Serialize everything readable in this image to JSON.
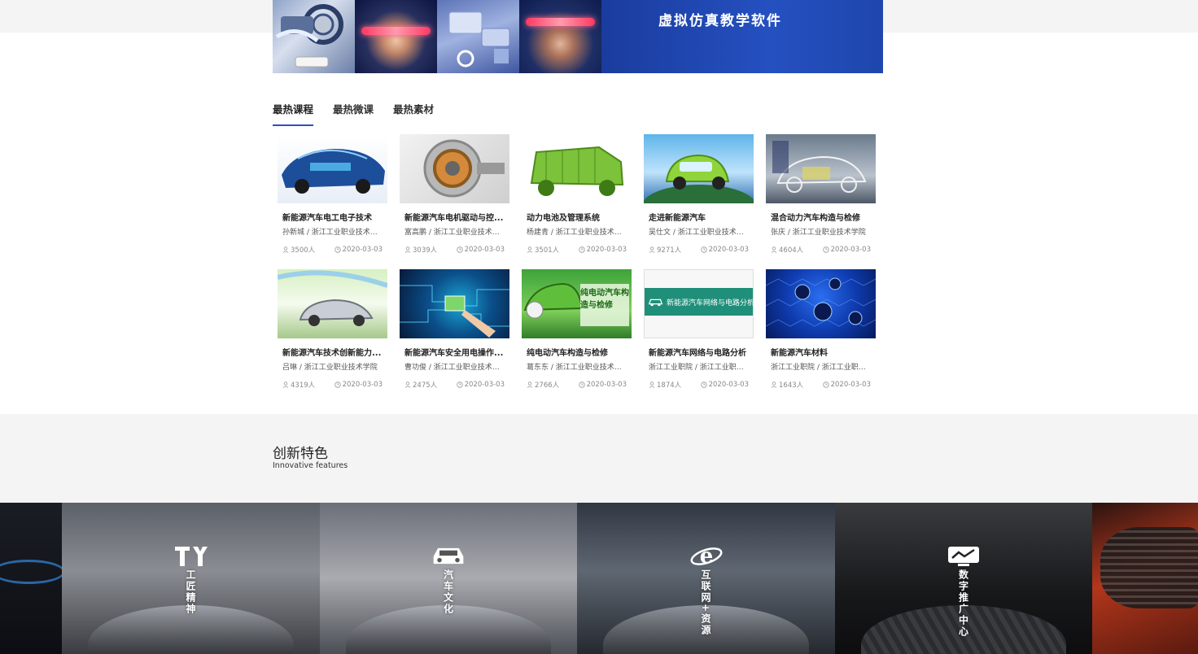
{
  "banner": {
    "title": "虚拟仿真教学软件"
  },
  "tabs": [
    {
      "label": "最热课程",
      "active": true
    },
    {
      "label": "最热微课",
      "active": false
    },
    {
      "label": "最热素材",
      "active": false
    }
  ],
  "courses": [
    {
      "title": "新能源汽车电工电子技术",
      "sub": "孙新城 / 浙江工业职业技术学...",
      "count": "3500人",
      "date": "2020-03-03"
    },
    {
      "title": "新能源汽车电机驱动与控...",
      "sub": "富高鹏 / 浙江工业职业技术学...",
      "count": "3039人",
      "date": "2020-03-03"
    },
    {
      "title": "动力电池及管理系统",
      "sub": "杨建青 / 浙江工业职业技术学...",
      "count": "3501人",
      "date": "2020-03-03"
    },
    {
      "title": "走进新能源汽车",
      "sub": "吴仕文 / 浙江工业职业技术学...",
      "count": "9271人",
      "date": "2020-03-03"
    },
    {
      "title": "混合动力汽车构造与检修",
      "sub": "张庆 / 浙江工业职业技术学院",
      "count": "4604人",
      "date": "2020-03-03"
    },
    {
      "title": "新能源汽车技术创新能力...",
      "sub": "吕琳 / 浙江工业职业技术学院",
      "count": "4319人",
      "date": "2020-03-03"
    },
    {
      "title": "新能源汽车安全用电操作...",
      "sub": "曹功俊 / 浙江工业职业技术学...",
      "count": "2475人",
      "date": "2020-03-03"
    },
    {
      "title": "纯电动汽车构造与检修",
      "sub": "葛东东 / 浙江工业职业技术学...",
      "count": "2766人",
      "date": "2020-03-03"
    },
    {
      "title": "新能源汽车网络与电路分析",
      "sub": "浙江工业职院 / 浙江工业职业...",
      "count": "1874人",
      "date": "2020-03-03",
      "thumb_text": "新能源汽车网络与电路分析"
    },
    {
      "title": "新能源汽车材料",
      "sub": "浙江工业职院 / 浙江工业职业...",
      "count": "1643人",
      "date": "2020-03-03"
    }
  ],
  "thumb_overlay": {
    "ev_title": "纯电动汽车构造与检修"
  },
  "features": {
    "title": "创新特色",
    "subtitle": "Innovative features",
    "items": [
      {
        "label": "工匠精神",
        "icon": "tools-icon"
      },
      {
        "label": "汽车文化",
        "icon": "car-icon"
      },
      {
        "label": "互联网+资源",
        "icon": "internet-explorer-icon"
      },
      {
        "label": "数字推广中心",
        "icon": "chart-monitor-icon"
      }
    ]
  },
  "colors": {
    "accent": "#2e4fc4",
    "banner_blue": "#1d43a6"
  }
}
